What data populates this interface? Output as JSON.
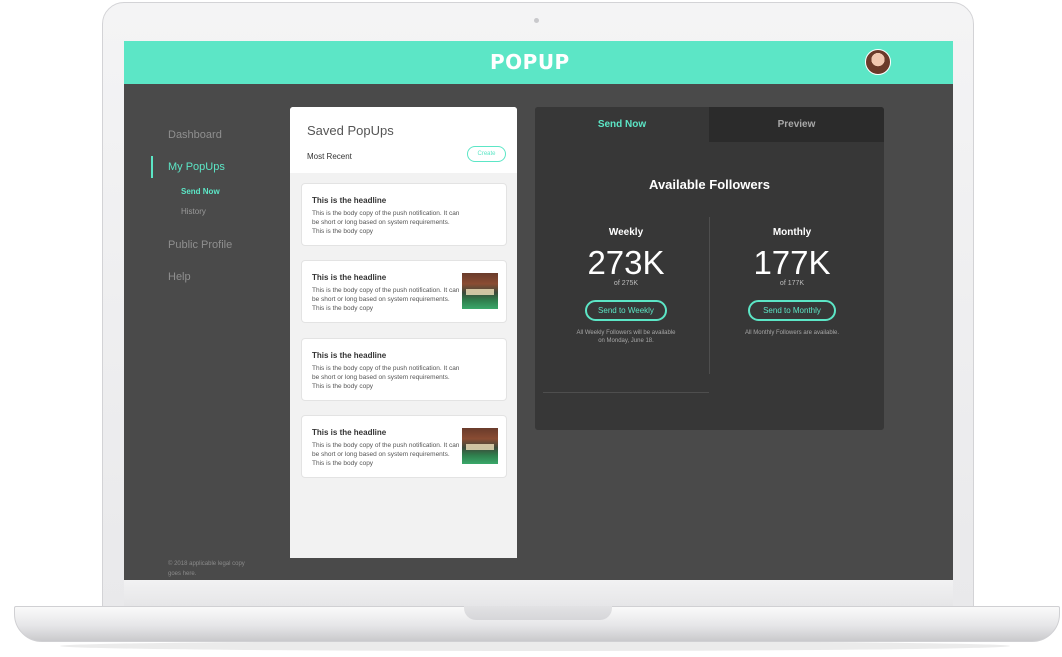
{
  "app": {
    "logo": "POPUP",
    "avatar_alt": "User avatar"
  },
  "sidebar": {
    "items": [
      {
        "label": "Dashboard",
        "active": false
      },
      {
        "label": "My PopUps",
        "active": true,
        "children": [
          {
            "label": "Send Now",
            "active": true
          },
          {
            "label": "History",
            "active": false
          }
        ]
      },
      {
        "label": "Public Profile",
        "active": false
      },
      {
        "label": "Help",
        "active": false
      }
    ],
    "legal": "© 2018 applicable legal copy goes here."
  },
  "saved": {
    "title": "Saved PopUps",
    "sort_label": "Most Recent",
    "create_label": "Create",
    "cards": [
      {
        "headline": "This is the headline",
        "body": "This is the body copy of the push notification. It can be short or long based on system requirements. This is the body copy",
        "has_image": false
      },
      {
        "headline": "This is the headline",
        "body": "This is the body copy of the push notification. It can be short or long based on system requirements. This is the body copy",
        "has_image": true
      },
      {
        "headline": "This is the headline",
        "body": "This is the body copy of the push notification. It can be short or long based on system requirements. This is the body copy",
        "has_image": false
      },
      {
        "headline": "This is the headline",
        "body": "This is the body copy of the push notification. It can be short or long based on system requirements. This is the body copy",
        "has_image": true
      }
    ]
  },
  "send": {
    "tabs": [
      {
        "label": "Send Now",
        "active": true
      },
      {
        "label": "Preview",
        "active": false
      }
    ],
    "title": "Available Followers",
    "weekly": {
      "label": "Weekly",
      "count": "273K",
      "of": "of 275K",
      "button": "Send to Weekly",
      "note": "All Weekly Followers will be available on Monday, June 18."
    },
    "monthly": {
      "label": "Monthly",
      "count": "177K",
      "of": "of 177K",
      "button": "Send to Monthly",
      "note": "All Monthly Followers are available."
    }
  },
  "colors": {
    "accent": "#5ce6c6",
    "screen_bg": "#4a4a4a",
    "panel_dark": "#373737"
  }
}
